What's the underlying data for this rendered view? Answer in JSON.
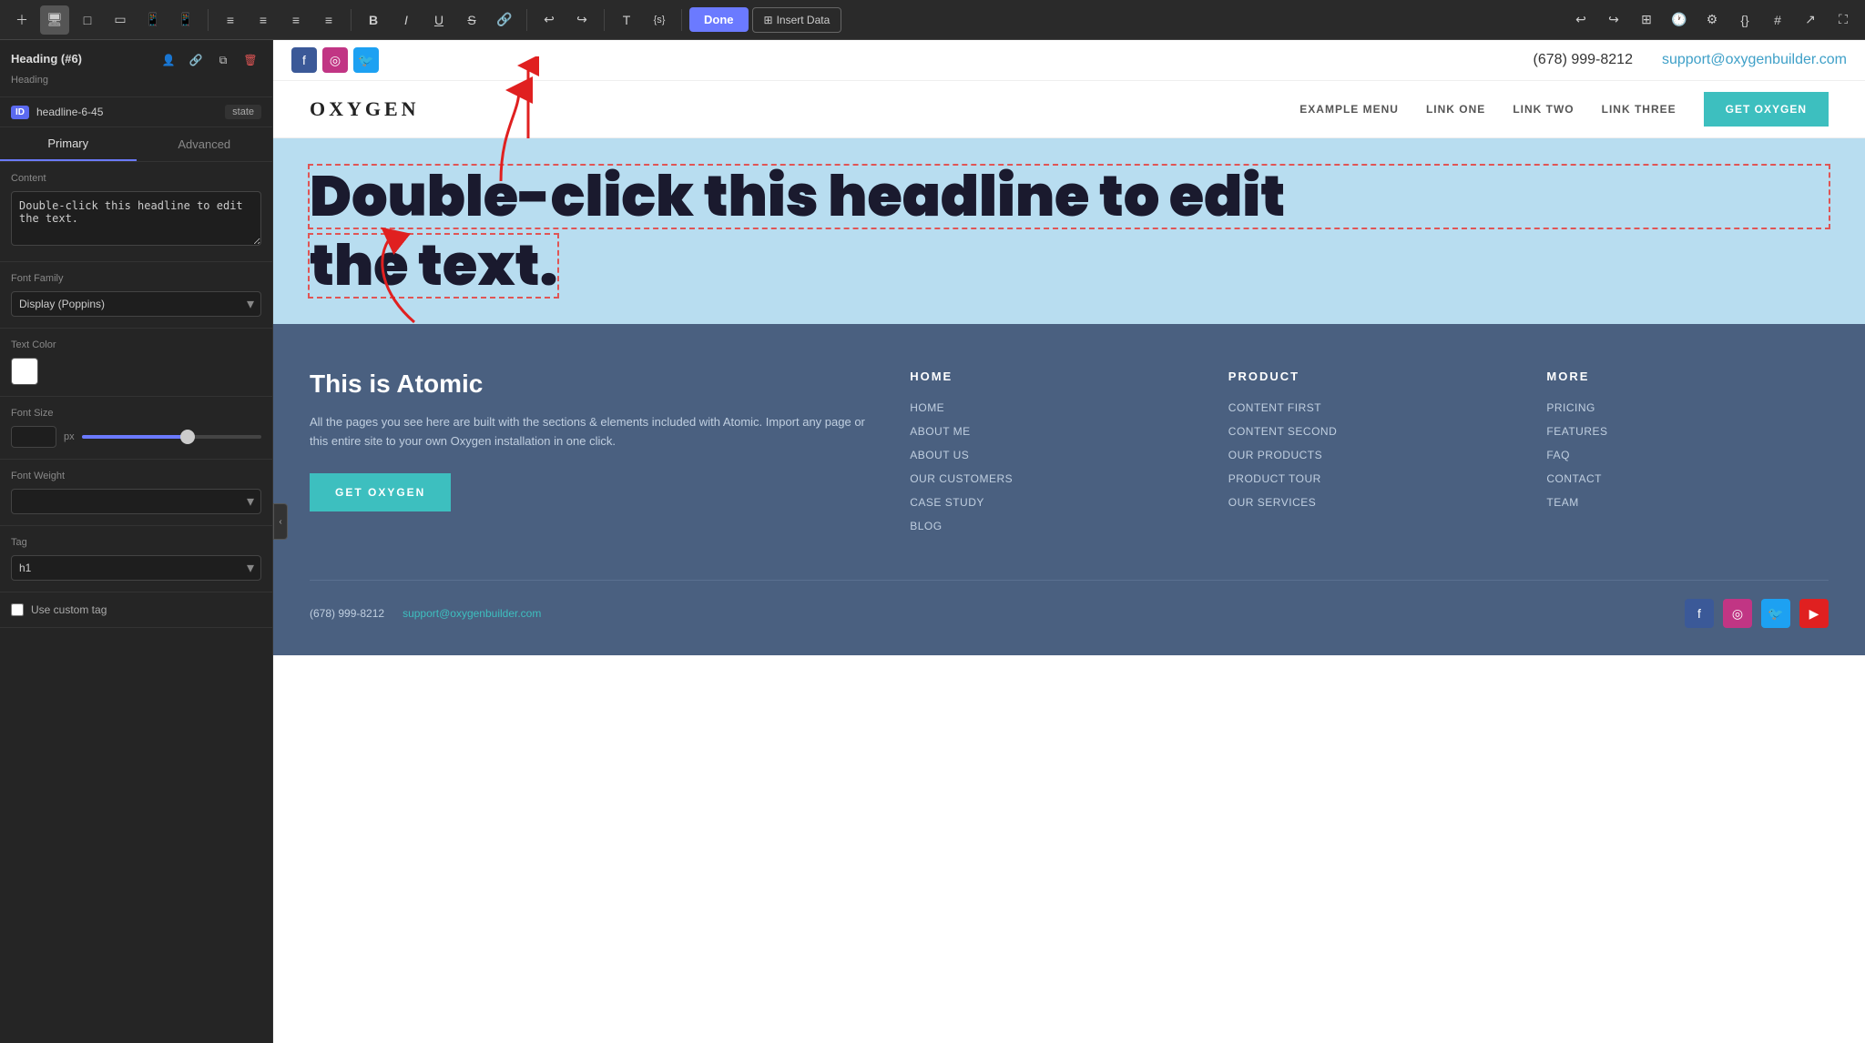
{
  "toolbar": {
    "done_label": "Done",
    "insert_data_label": "Insert Data",
    "align_left": "≡",
    "align_center": "≡",
    "align_right": "≡",
    "align_justify": "≡",
    "bold": "B",
    "italic": "I",
    "underline": "U",
    "strikethrough": "S",
    "link": "🔗",
    "undo": "↩",
    "redo": "↪",
    "text_icon": "T",
    "code": "{s}"
  },
  "left_panel": {
    "title": "Heading (#6)",
    "subtitle": "Heading",
    "element_id": "headline-6-45",
    "state_label": "state",
    "tabs": [
      "Primary",
      "Advanced"
    ],
    "active_tab": "Primary",
    "content": {
      "label": "Content",
      "value": "Double-click this headline to edit the text."
    },
    "font_family": {
      "label": "Font Family",
      "value": "Display (Poppins)"
    },
    "text_color": {
      "label": "Text Color",
      "value": "#ffffff"
    },
    "font_size": {
      "label": "Font Size",
      "unit": "px",
      "value": ""
    },
    "font_weight": {
      "label": "Font Weight",
      "value": ""
    },
    "tag": {
      "label": "Tag",
      "value": "h1"
    },
    "custom_tag": {
      "label": "Use custom tag",
      "checked": false
    }
  },
  "site": {
    "topbar": {
      "phone": "(678) 999-8212",
      "email": "support@oxygenbuilder.com"
    },
    "nav": {
      "logo": "OXYGEN",
      "links": [
        "EXAMPLE MENU",
        "LINK ONE",
        "LINK TWO",
        "LINK THREE"
      ],
      "cta": "GET OXYGEN"
    },
    "social": [
      "f",
      "📷",
      "🐦"
    ],
    "hero": {
      "heading_line1": "Double-click this headline to edit",
      "heading_line2": "the text."
    },
    "footer": {
      "company": "This is Atomic",
      "description": "All the pages you see here are built with the sections & elements included with Atomic. Import any page or this entire site to your own Oxygen installation in one click.",
      "cta": "GET OXYGEN",
      "col1_title": "HOME",
      "col1_links": [
        "HOME",
        "ABOUT ME",
        "ABOUT US",
        "OUR CUSTOMERS",
        "CASE STUDY",
        "BLOG"
      ],
      "col2_title": "PRODUCT",
      "col2_links": [
        "CONTENT FIRST",
        "CONTENT SECOND",
        "OUR PRODUCTS",
        "PRODUCT TOUR",
        "OUR SERVICES"
      ],
      "col3_title": "MORE",
      "col3_links": [
        "PRICING",
        "FEATURES",
        "FAQ",
        "CONTACT",
        "TEAM"
      ],
      "bottom_phone": "(678) 999-8212",
      "bottom_email": "support@oxygenbuilder.com"
    }
  }
}
